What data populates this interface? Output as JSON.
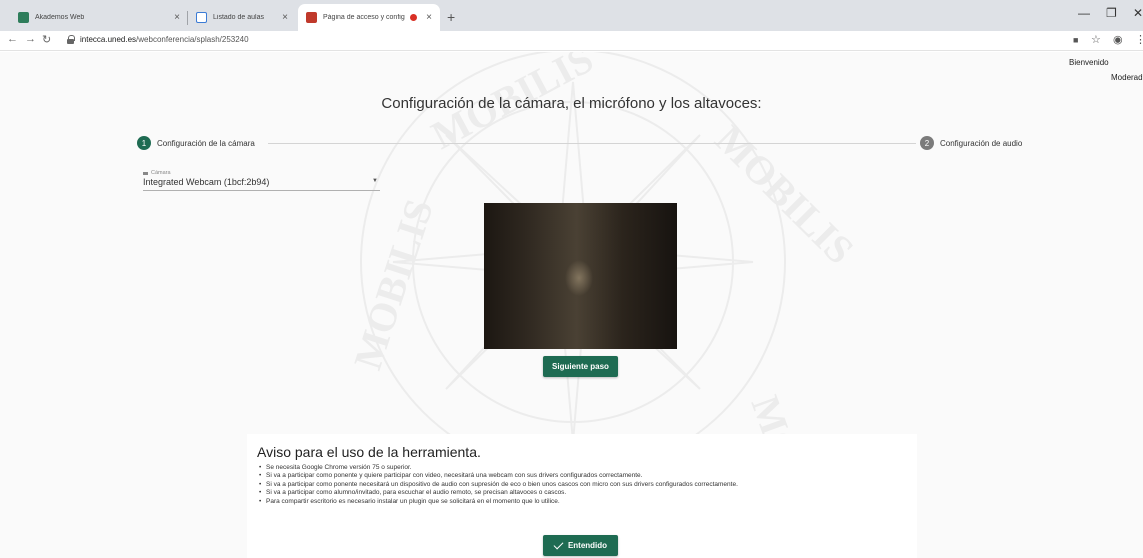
{
  "browser": {
    "tabs": [
      {
        "title": "Akademos Web",
        "favicon_color": "#2e7d5b"
      },
      {
        "title": "Listado de aulas",
        "favicon_color": "#3b7bd5"
      },
      {
        "title": "Página de acceso y configura",
        "favicon_color": "#c0392b",
        "recording": true,
        "active": true
      }
    ],
    "url_host": "intecca.uned.es",
    "url_path": "/webconferencia/splash/253240",
    "icons": [
      "back-icon",
      "forward-icon",
      "reload-icon",
      "lock-icon",
      "camera-icon",
      "star-icon",
      "account-icon",
      "menu-icon"
    ]
  },
  "header": {
    "welcome": "Bienvenido",
    "role": "Moderad"
  },
  "title": "Configuración de la cámara, el micrófono y los altavoces:",
  "steps": [
    {
      "number": "1",
      "label": "Configuración de la cámara",
      "active": true
    },
    {
      "number": "2",
      "label": "Configuración de audio",
      "active": false
    }
  ],
  "camera": {
    "label": "Cámara",
    "selected": "Integrated Webcam (1bcf:2b94)"
  },
  "next_button": "Siguiente paso",
  "notice": {
    "title": "Aviso para el uso de la herramienta.",
    "items": [
      "Se necesita Google Chrome versión 75 o superior.",
      "Si va a participar como ponente y quiere participar con video, necesitará una webcam con sus drivers configurados correctamente.",
      "Si va a participar como ponente necesitará un dispositivo de audio con supresión de eco o bien unos cascos con micro con sus drivers configurados correctamente.",
      "Si va a participar como alumno/invitado, para escuchar el audio remoto, se precisan altavoces o cascos.",
      "Para compartir escritorio es necesario instalar un plugin que se solicitará en el momento que lo utilice."
    ],
    "button": "Entendido"
  },
  "colors": {
    "accent": "#1e6b52",
    "inactive_step": "#7b7b7b",
    "page_bg": "#fafafa"
  }
}
